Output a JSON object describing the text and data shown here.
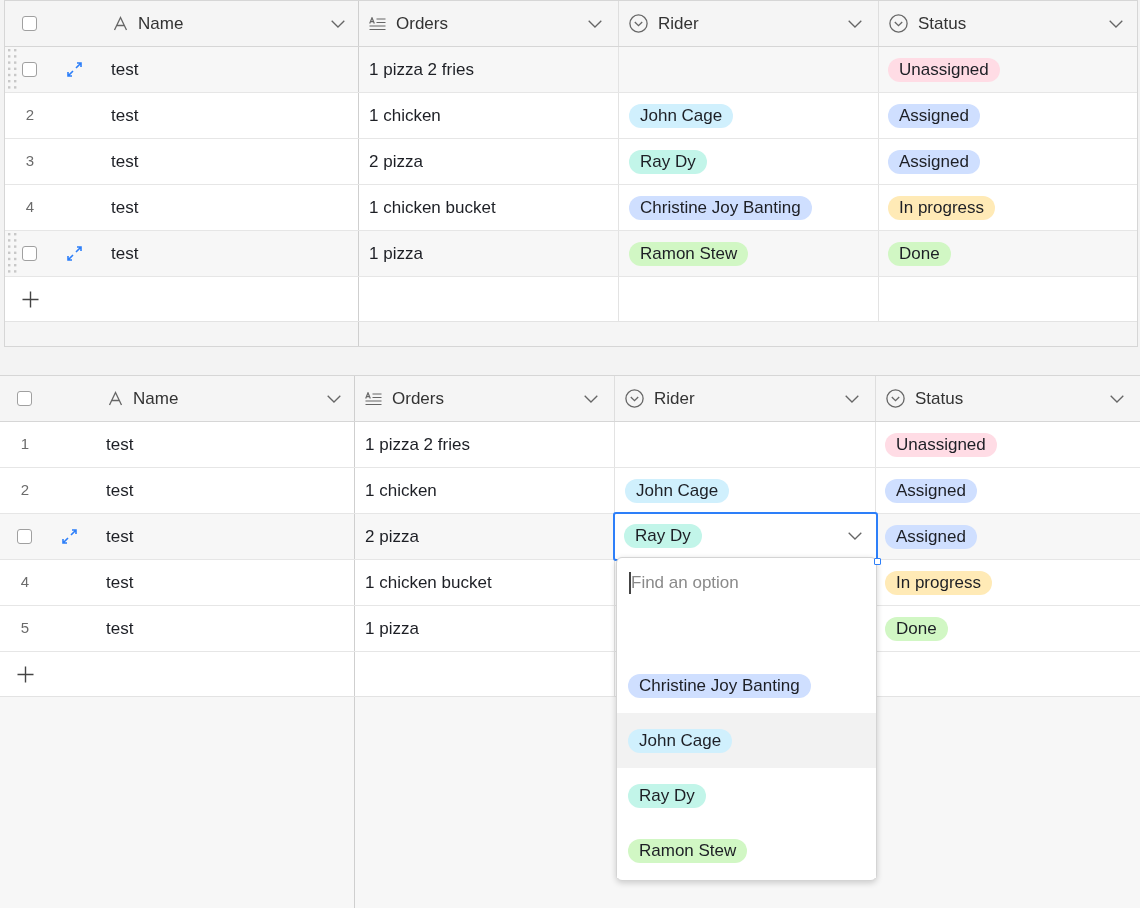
{
  "tables": [
    {
      "select_all": {
        "checked": false
      },
      "columns": [
        {
          "label": "Name",
          "kind": "text"
        },
        {
          "label": "Orders",
          "kind": "long_text"
        },
        {
          "label": "Rider",
          "kind": "single_select"
        },
        {
          "label": "Status",
          "kind": "single_select"
        }
      ],
      "rows": [
        {
          "hovered": true,
          "drag_handle": true,
          "checked": false,
          "name": "test",
          "orders": "1 pizza 2 fries",
          "status": {
            "label": "Unassigned",
            "color": "#ffdce5"
          }
        },
        {
          "hovered": false,
          "number": "2",
          "name": "test",
          "orders": "1 chicken",
          "rider": {
            "label": "John Cage",
            "color": "#d0f0fd",
            "editing": false
          },
          "status": {
            "label": "Assigned",
            "color": "#cfdfff"
          }
        },
        {
          "hovered": false,
          "number": "3",
          "name": "test",
          "orders": "2 pizza",
          "rider": {
            "label": "Ray Dy",
            "color": "#c2f5e9",
            "editing": false
          },
          "status": {
            "label": "Assigned",
            "color": "#cfdfff"
          }
        },
        {
          "hovered": false,
          "number": "4",
          "name": "test",
          "orders": "1 chicken bucket",
          "rider": {
            "label": "Christine Joy Banting",
            "color": "#cfdfff",
            "editing": false
          },
          "status": {
            "label": "In progress",
            "color": "#ffeab6"
          }
        },
        {
          "hovered": true,
          "drag_handle": true,
          "checked": false,
          "name": "test",
          "orders": "1 pizza",
          "rider": {
            "label": "Ramon Stew",
            "color": "#d1f7c4",
            "editing": false
          },
          "status": {
            "label": "Done",
            "color": "#d1f7c4"
          }
        }
      ]
    },
    {
      "select_all": {
        "checked": false
      },
      "columns": [
        {
          "label": "Name",
          "kind": "text"
        },
        {
          "label": "Orders",
          "kind": "long_text"
        },
        {
          "label": "Rider",
          "kind": "single_select"
        },
        {
          "label": "Status",
          "kind": "single_select"
        }
      ],
      "rows": [
        {
          "hovered": false,
          "number": "1",
          "name": "test",
          "orders": "1 pizza 2 fries",
          "status": {
            "label": "Unassigned",
            "color": "#ffdce5"
          }
        },
        {
          "hovered": false,
          "number": "2",
          "name": "test",
          "orders": "1 chicken",
          "rider": {
            "label": "John Cage",
            "color": "#d0f0fd",
            "editing": false
          },
          "status": {
            "label": "Assigned",
            "color": "#cfdfff"
          }
        },
        {
          "hovered": true,
          "drag_handle": false,
          "checked": false,
          "name": "test",
          "orders": "2 pizza",
          "rider": {
            "label": "Ray Dy",
            "color": "#c2f5e9",
            "editing": true,
            "dropdown": {
              "placeholder": "Find an option",
              "options": [
                {
                  "label": "Christine Joy Banting",
                  "color": "#cfdfff",
                  "highlighted": false
                },
                {
                  "label": "John Cage",
                  "color": "#d0f0fd",
                  "highlighted": true
                },
                {
                  "label": "Ray Dy",
                  "color": "#c2f5e9",
                  "highlighted": false
                },
                {
                  "label": "Ramon Stew",
                  "color": "#d1f7c4",
                  "highlighted": false
                }
              ]
            }
          },
          "status": {
            "label": "Assigned",
            "color": "#cfdfff"
          }
        },
        {
          "hovered": false,
          "number": "4",
          "name": "test",
          "orders": "1 chicken bucket",
          "status": {
            "label": "In progress",
            "color": "#ffeab6"
          }
        },
        {
          "hovered": false,
          "number": "5",
          "name": "test",
          "orders": "1 pizza",
          "status": {
            "label": "Done",
            "color": "#d1f7c4"
          }
        }
      ]
    }
  ]
}
